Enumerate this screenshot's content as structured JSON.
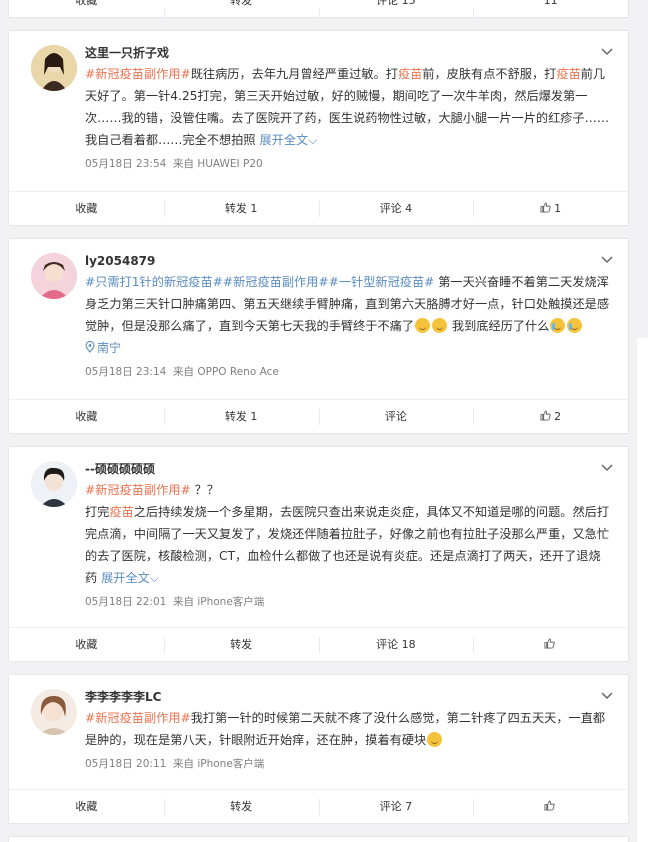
{
  "top_fragment": {
    "actions": [
      "收藏",
      "转发",
      "评论 15",
      "11"
    ]
  },
  "posts": [
    {
      "username": "这里一只折子戏",
      "segments": [
        {
          "t": "link",
          "v": "#新冠疫苗副作用#"
        },
        {
          "t": "text",
          "v": "既往病历，去年九月曾经严重过敏。打"
        },
        {
          "t": "link",
          "v": "疫苗"
        },
        {
          "t": "text",
          "v": "前，皮肤有点不舒服，打"
        },
        {
          "t": "link",
          "v": "疫苗"
        },
        {
          "t": "text",
          "v": "前几天好了。第一针4.25打完，第三天开始过敏，好的贼慢，期间吃了一次牛羊肉，然后爆发第一次……我的错，没管住嘴。去了医院开了药，医生说药物性过敏，大腿小腿一片一片的红疹子……我自己看着都……完全不想拍照 "
        },
        {
          "t": "tag",
          "v": "展开全文⌵"
        }
      ],
      "time": "05月18日 23:54",
      "source": "来自 HUAWEI P20",
      "actions": [
        "收藏",
        "转发 1",
        "评论 4",
        "1"
      ]
    },
    {
      "username": "ly2054879",
      "segments": [
        {
          "t": "tag",
          "v": "#只需打1针的新冠疫苗#"
        },
        {
          "t": "tag",
          "v": "#新冠疫苗副作用#"
        },
        {
          "t": "tag",
          "v": "#一针型新冠疫苗#"
        },
        {
          "t": "text",
          "v": " 第一天兴奋睡不着第二天发烧浑身乏力第三天针口肿痛第四、第五天继续手臂肿痛，直到第六天胳膊才好一点，针口处触摸还是感觉肿，但是没那么痛了，直到今天第七天我的手臂终于不痛了"
        },
        {
          "t": "emoji",
          "v": "laugh"
        },
        {
          "t": "emoji",
          "v": "laugh"
        },
        {
          "t": "text",
          "v": " 我到底经历了什么"
        },
        {
          "t": "emoji",
          "v": "cry"
        },
        {
          "t": "emoji",
          "v": "cry"
        }
      ],
      "location": "南宁",
      "time": "05月18日 23:14",
      "source": "来自 OPPO Reno Ace",
      "actions": [
        "收藏",
        "转发 1",
        "评论",
        "2"
      ]
    },
    {
      "username": "--硕硕硕硕硕",
      "segments": [
        {
          "t": "link",
          "v": "#新冠疫苗副作用#"
        },
        {
          "t": "text",
          "v": " ？？"
        },
        {
          "t": "br",
          "v": ""
        },
        {
          "t": "text",
          "v": "打完"
        },
        {
          "t": "link",
          "v": "疫苗"
        },
        {
          "t": "text",
          "v": "之后持续发烧一个多星期，去医院只查出来说走炎症，具体又不知道是哪的问题。然后打完点滴，中间隔了一天又复发了，发烧还伴随着拉肚子，好像之前也有拉肚子没那么严重，又急忙的去了医院，核酸检测，CT，血检什么都做了也还是说有炎症。还是点滴打了两天，还开了退烧药 "
        },
        {
          "t": "tag",
          "v": "展开全文⌵"
        }
      ],
      "time": "05月18日 22:01",
      "source": "来自 iPhone客户端",
      "actions": [
        "收藏",
        "转发",
        "评论 18",
        ""
      ]
    },
    {
      "username": "李李李李李LC",
      "segments": [
        {
          "t": "link",
          "v": "#新冠疫苗副作用#"
        },
        {
          "t": "text",
          "v": "我打第一针的时候第二天就不疼了没什么感觉，第二针疼了四五天天，一直都是肿的，现在是第八天，针眼附近开始痒，还在肿，摸着有硬块"
        },
        {
          "t": "emoji",
          "v": "surprise"
        }
      ],
      "time": "05月18日 20:11",
      "source": "来自 iPhone客户端",
      "actions": [
        "收藏",
        "转发",
        "评论 7",
        ""
      ]
    }
  ]
}
